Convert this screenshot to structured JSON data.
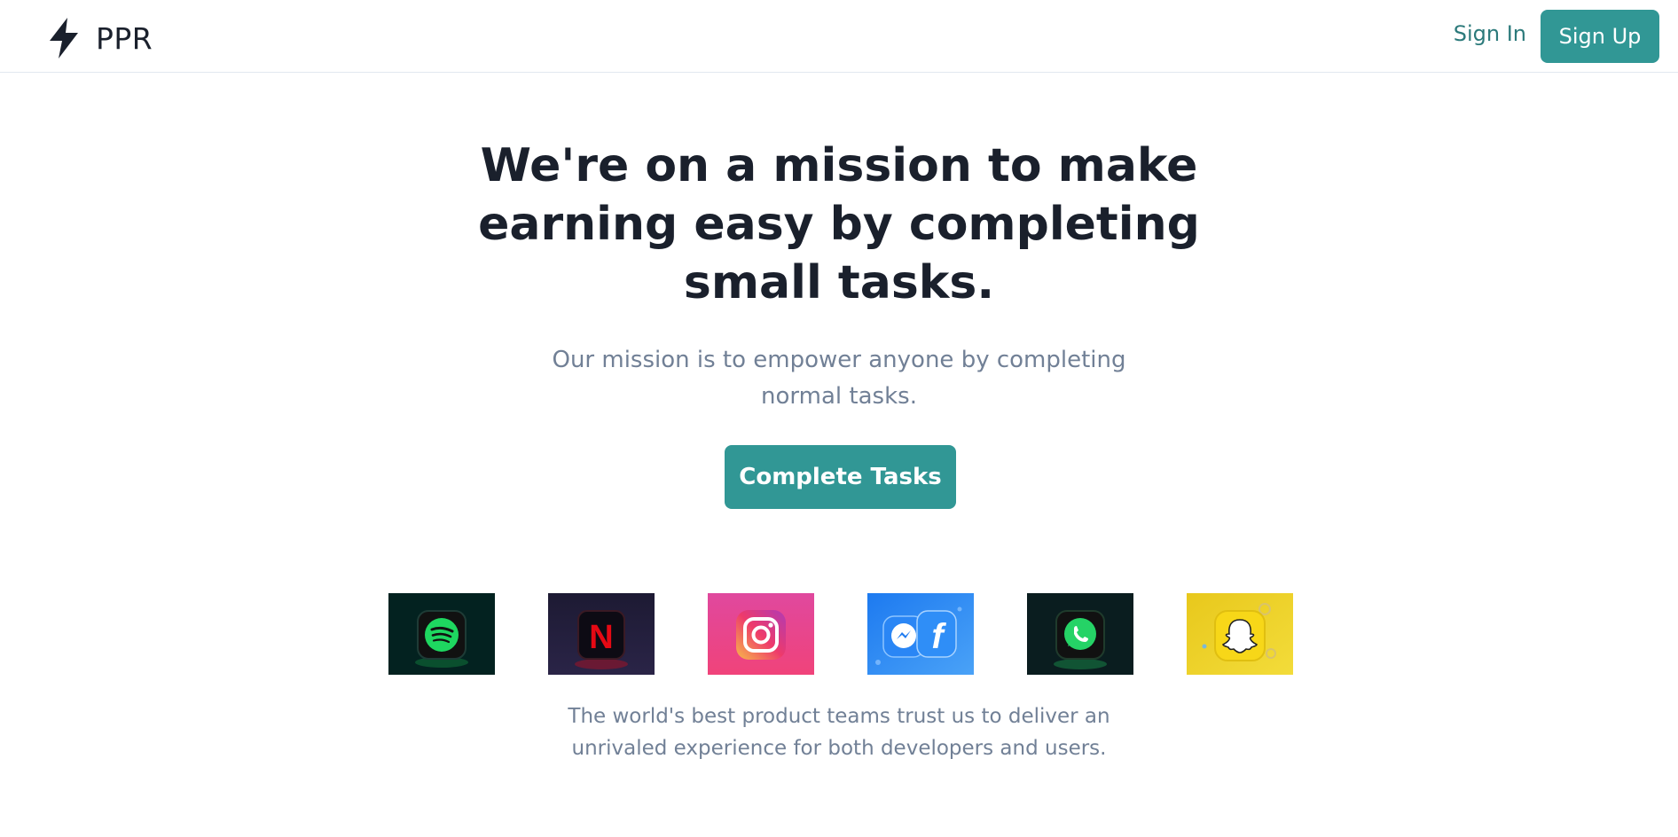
{
  "nav": {
    "brand": "PPR",
    "signin_label": "Sign In",
    "signup_label": "Sign Up"
  },
  "hero": {
    "title": "We're on a mission to make earning easy by completing small tasks.",
    "subtitle": "Our mission is to empower anyone by completing normal tasks.",
    "cta_label": "Complete Tasks"
  },
  "logos": [
    {
      "name": "spotify",
      "icon": "spotify-icon"
    },
    {
      "name": "netflix",
      "icon": "netflix-icon",
      "glyph": "N"
    },
    {
      "name": "instagram",
      "icon": "instagram-icon"
    },
    {
      "name": "messenger-facebook",
      "icon": "messenger-facebook-icon",
      "glyph": "f"
    },
    {
      "name": "whatsapp",
      "icon": "whatsapp-icon"
    },
    {
      "name": "snapchat",
      "icon": "snapchat-icon"
    }
  ],
  "footer": {
    "trust_text": "The world's best product teams trust us to deliver an unrivaled experience for both developers and users."
  },
  "colors": {
    "accent": "#319795",
    "accent_text": "#2c7a7b",
    "heading": "#1a202c",
    "muted": "#718096"
  }
}
